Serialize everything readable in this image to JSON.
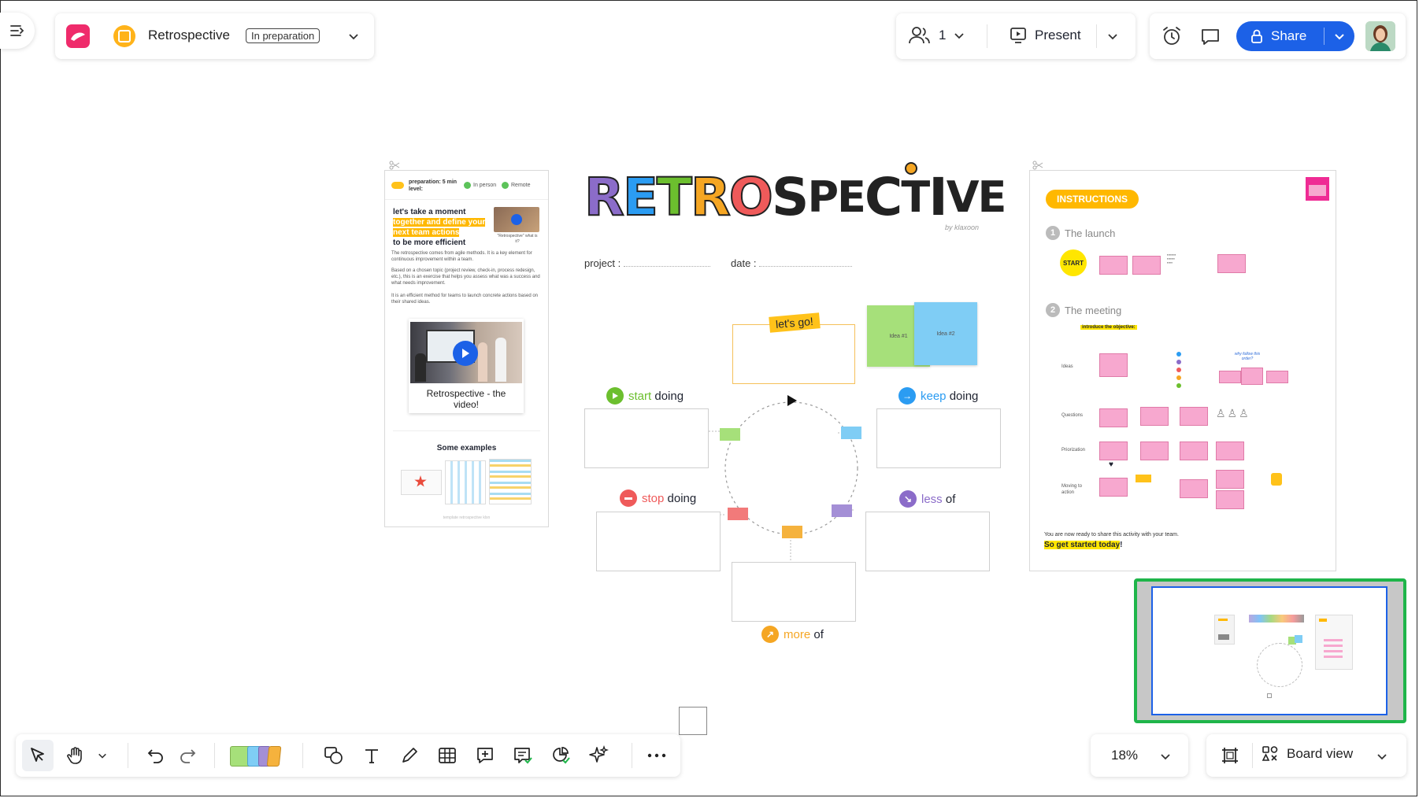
{
  "header": {
    "board_title": "Retrospective",
    "status_badge": "In preparation",
    "participants_count": "1",
    "present_label": "Present",
    "share_label": "Share"
  },
  "board": {
    "title_letters": [
      "R",
      "E",
      "T",
      "R",
      "O",
      "S",
      "P",
      "E",
      "C",
      "T",
      "I",
      "V",
      "E"
    ],
    "by_line": "by klaxoon",
    "project_label": "project :",
    "date_label": "date :",
    "lets_go": "let's go!",
    "idea1": "Idea #1",
    "idea2": "Idea #2",
    "start": {
      "word": "start",
      "rest": " doing"
    },
    "keep": {
      "word": "keep",
      "rest": " doing"
    },
    "stop": {
      "word": "stop",
      "rest": " doing"
    },
    "less": {
      "word": "less",
      "rest": " of"
    },
    "more": {
      "word": "more",
      "rest": " of"
    }
  },
  "left_card": {
    "prep": "preparation: 5 min",
    "level": "level:",
    "in_person": "In person",
    "remote": "Remote",
    "intro_line1": "let's take a moment",
    "intro_highlight1": "together and define your",
    "intro_highlight2": "next team actions",
    "intro_line4": "to be more efficient",
    "video_caption_small": "\"Retrospective\" what is it?",
    "para1": "The retrospective comes from agile methods. It is a key element for continuous improvement within a team.",
    "para2": "Based on a chosen topic (project review, check-in, process redesign, etc.), this is an exercise that helps you assess what was a success and what needs improvement.",
    "para3": "It is an efficient method for teams to launch concrete actions based on their shared ideas.",
    "video_title": "Retrospective - the video!",
    "examples_title": "Some examples",
    "footer": "template retrospective klxn"
  },
  "right_card": {
    "instructions": "INSTRUCTIONS",
    "step1": "The launch",
    "step2": "The meeting",
    "start_badge": "START",
    "introduce": "introduce the objective:",
    "rows": [
      "Ideas",
      "Questions",
      "Priorization",
      "Moving to action"
    ],
    "why_follow": "why follow this order?",
    "ready_text": "You are now ready to share this activity with your team.",
    "get_started": "So get started today",
    "get_started_end": "!"
  },
  "toolbar": {
    "zoom": "18%",
    "board_view": "Board view"
  },
  "colors": {
    "share_blue": "#1c61e7",
    "minimap_border": "#1fb54a",
    "start_green": "#6cbf2e",
    "keep_blue": "#2b9cf2",
    "stop_red": "#ef5a5a",
    "less_purple": "#8b6cc9",
    "more_orange": "#f5a623",
    "highlight_yellow": "#ffd500"
  }
}
